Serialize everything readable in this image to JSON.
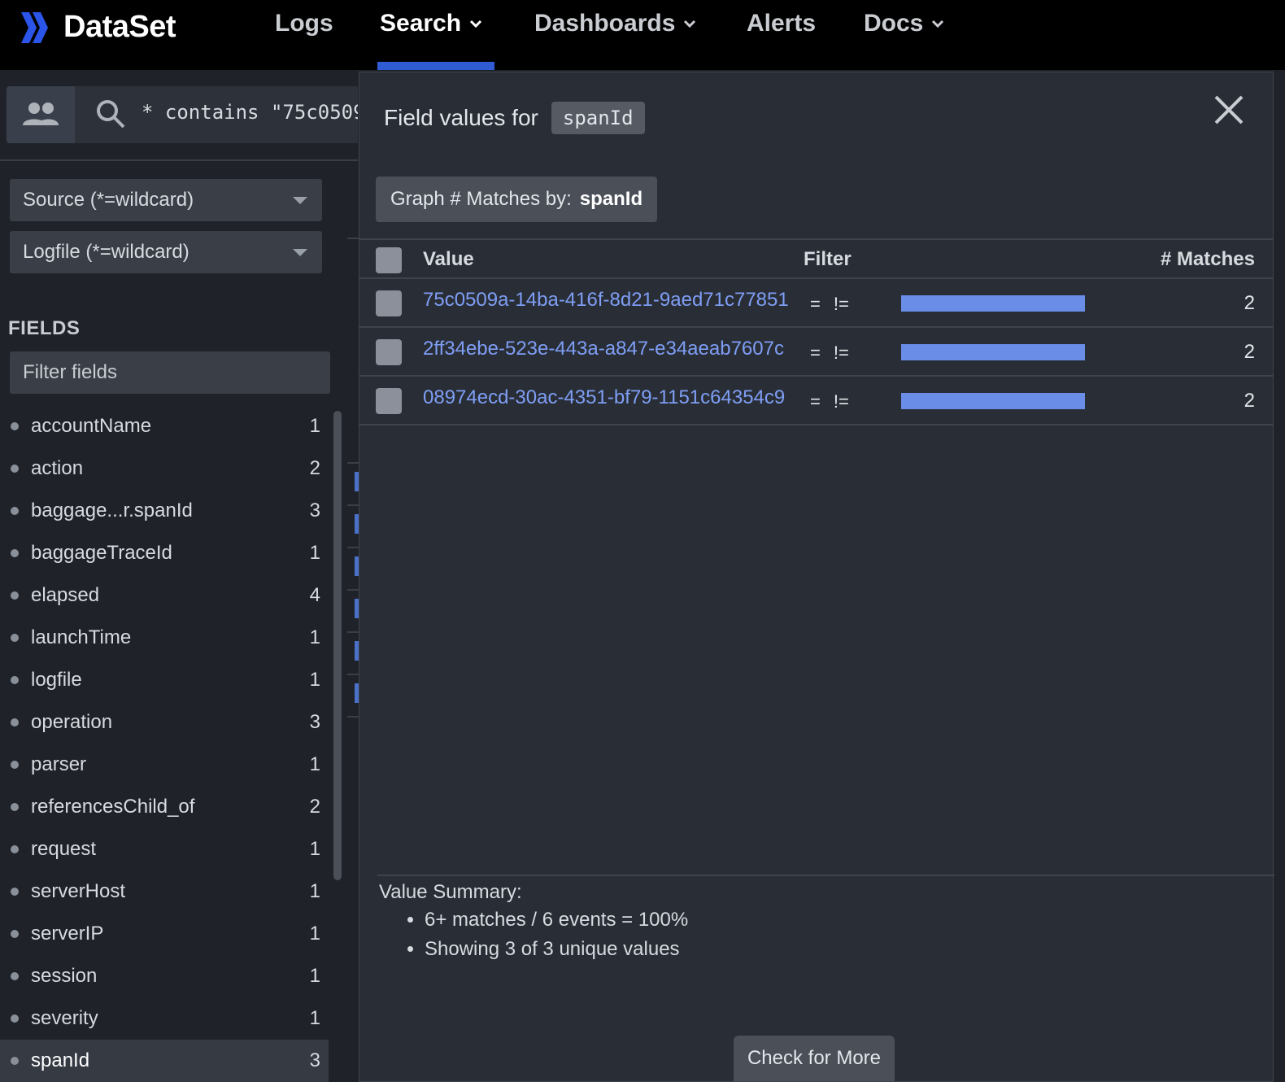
{
  "app": {
    "name": "DataSet"
  },
  "nav": {
    "items": [
      {
        "label": "Logs",
        "has_menu": false
      },
      {
        "label": "Search",
        "has_menu": true,
        "active": true
      },
      {
        "label": "Dashboards",
        "has_menu": true
      },
      {
        "label": "Alerts",
        "has_menu": false
      },
      {
        "label": "Docs",
        "has_menu": true
      }
    ]
  },
  "search": {
    "query": "* contains \"75c0509"
  },
  "filters": {
    "source_placeholder": "Source (*=wildcard)",
    "logfile_placeholder": "Logfile (*=wildcard)"
  },
  "fields": {
    "heading": "FIELDS",
    "filter_placeholder": "Filter fields",
    "items": [
      {
        "name": "accountName",
        "count": "1"
      },
      {
        "name": "action",
        "count": "2"
      },
      {
        "name": "baggage...r.spanId",
        "count": "3"
      },
      {
        "name": "baggageTraceId",
        "count": "1"
      },
      {
        "name": "elapsed",
        "count": "4"
      },
      {
        "name": "launchTime",
        "count": "1"
      },
      {
        "name": "logfile",
        "count": "1"
      },
      {
        "name": "operation",
        "count": "3"
      },
      {
        "name": "parser",
        "count": "1"
      },
      {
        "name": "referencesChild_of",
        "count": "2"
      },
      {
        "name": "request",
        "count": "1"
      },
      {
        "name": "serverHost",
        "count": "1"
      },
      {
        "name": "serverIP",
        "count": "1"
      },
      {
        "name": "session",
        "count": "1"
      },
      {
        "name": "severity",
        "count": "1"
      },
      {
        "name": "spanId",
        "count": "3",
        "selected": true
      }
    ]
  },
  "modal": {
    "title": "Field values for",
    "field": "spanId",
    "graph_label": "Graph # Matches by:",
    "graph_field": "spanId",
    "columns": {
      "value": "Value",
      "filter": "Filter",
      "matches": "# Matches"
    },
    "filter_eq": "=",
    "filter_neq": "!=",
    "rows": [
      {
        "value": "75c0509a-14ba-416f-8d21-9aed71c77851",
        "matches": "2",
        "fraction": 1.0
      },
      {
        "value": "2ff34ebe-523e-443a-a847-e34aeab7607c",
        "matches": "2",
        "fraction": 1.0
      },
      {
        "value": "08974ecd-30ac-4351-bf79-1151c64354c9",
        "matches": "2",
        "fraction": 1.0
      }
    ],
    "summary_title": "Value Summary:",
    "summary_items": [
      "6+ matches / 6 events = 100%",
      "Showing 3 of 3 unique values"
    ],
    "check_more": "Check for More"
  },
  "colors": {
    "accent": "#2f5bd3",
    "link": "#7f9ef5",
    "bar": "#6a8ee8"
  }
}
